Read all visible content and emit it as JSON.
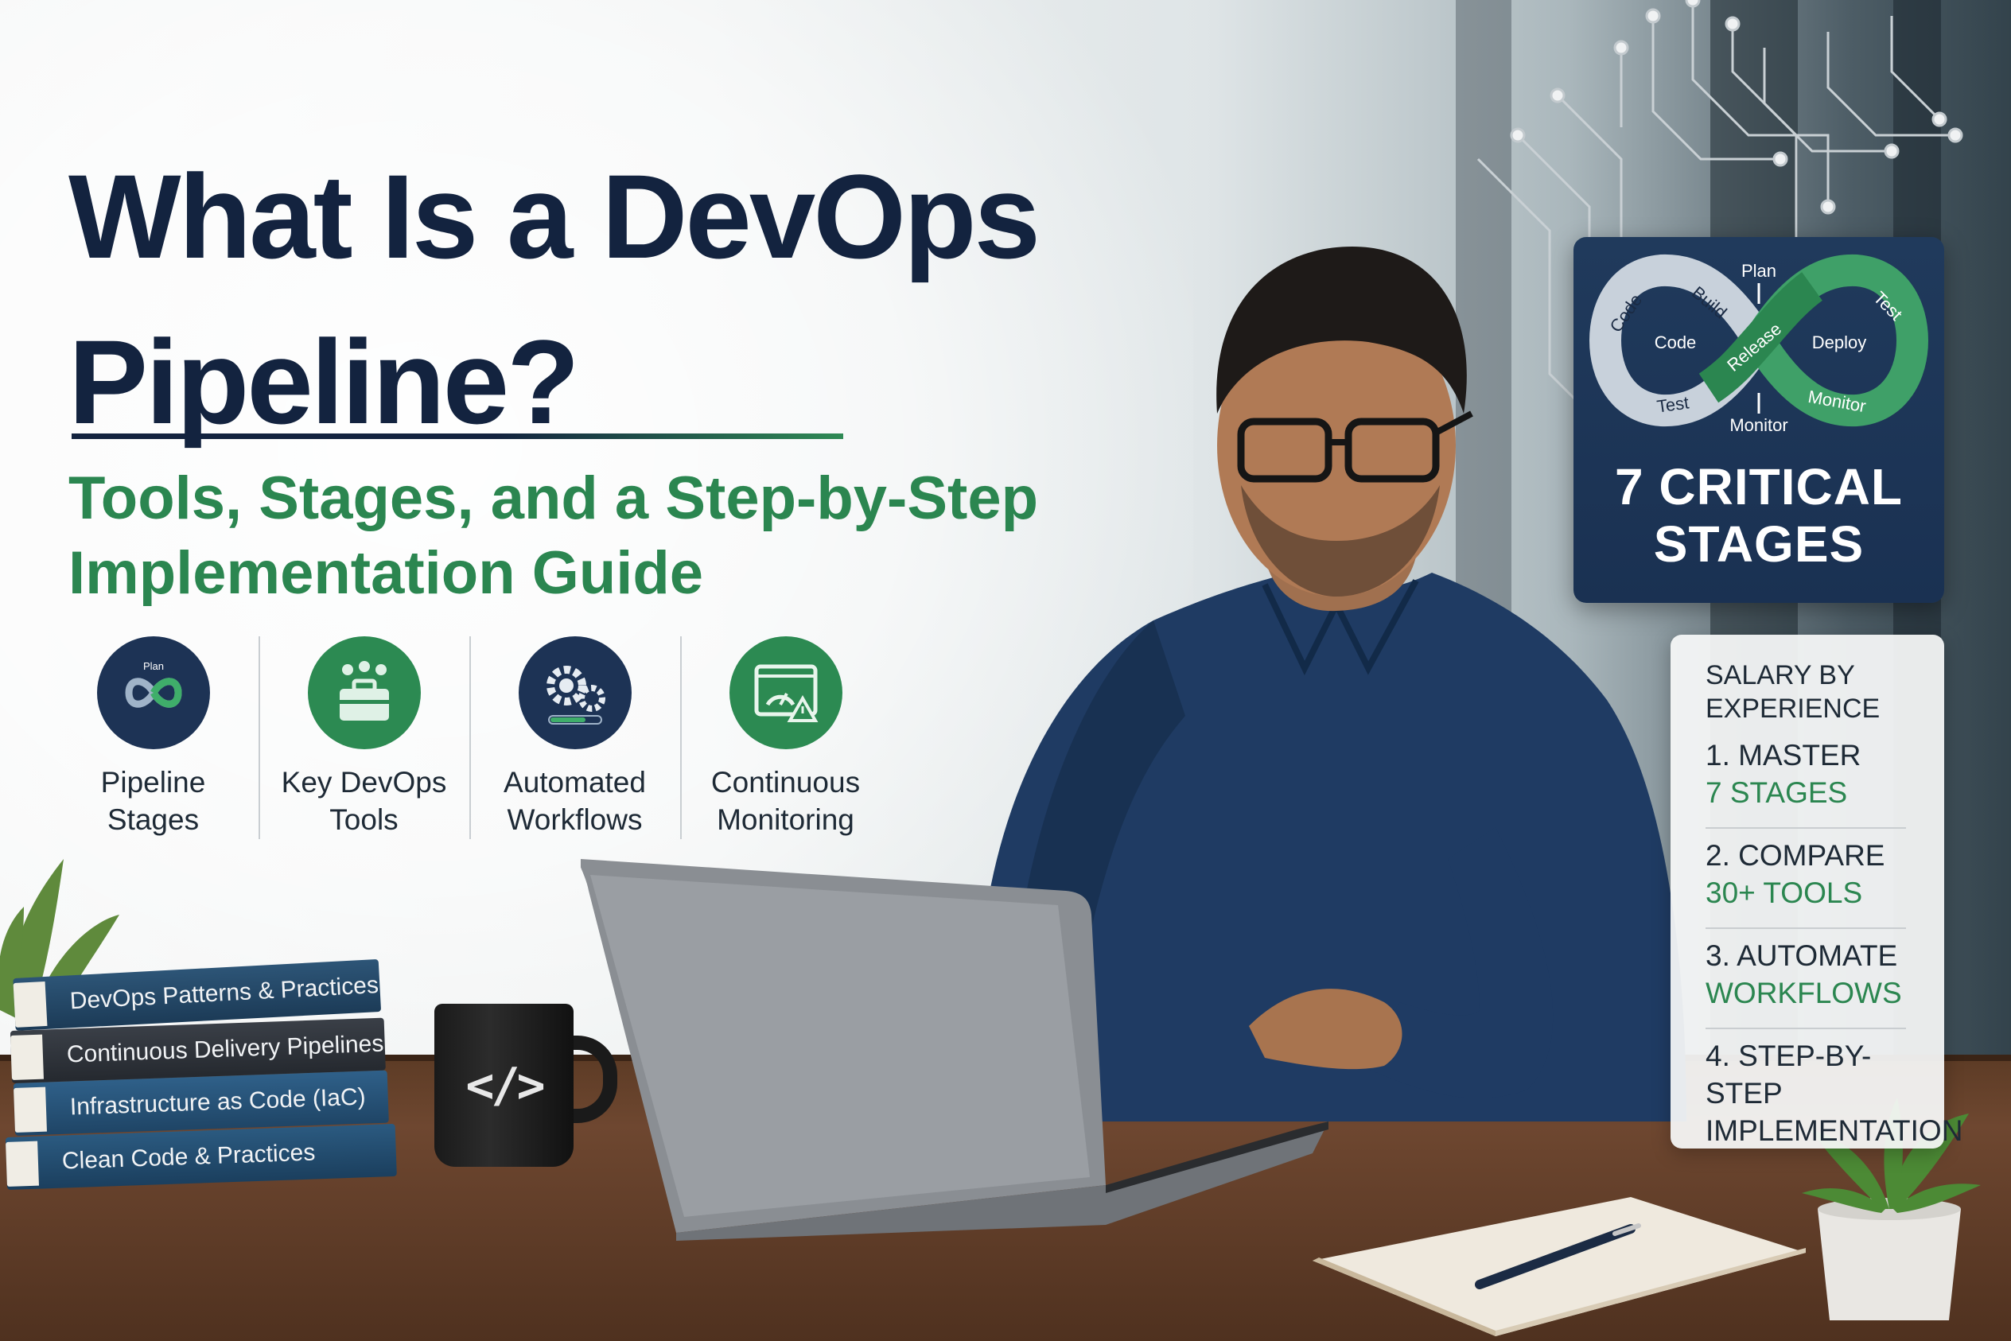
{
  "headline": {
    "title_line1": "What Is a DevOps",
    "title_line2": "Pipeline?",
    "subtitle_line1": "Tools, Stages, and a Step-by-Step",
    "subtitle_line2": "Implementation Guide"
  },
  "features": [
    {
      "line1": "Pipeline",
      "line2": "Stages",
      "icon": "infinity-loop-icon",
      "icon_text": "Plan"
    },
    {
      "line1": "Key DevOps",
      "line2": "Tools",
      "icon": "toolbox-icon"
    },
    {
      "line1": "Automated",
      "line2": "Workflows",
      "icon": "gears-icon"
    },
    {
      "line1": "Continuous",
      "line2": "Monitoring",
      "icon": "dashboard-alert-icon"
    }
  ],
  "stages_card": {
    "loop_labels": {
      "plan": "Plan",
      "code_outer": "Code",
      "build": "Build",
      "test_outer": "Test",
      "code_inner": "Code",
      "release": "Release",
      "deploy": "Deploy",
      "test_bottom": "Test",
      "monitor_outer": "Monitor",
      "monitor_bottom": "Monitor"
    },
    "line1": "7 CRITICAL",
    "line2": "STAGES"
  },
  "checklist": {
    "heading_line1": "SALARY BY",
    "heading_line2": "EXPERIENCE",
    "items": [
      {
        "a": "1. MASTER",
        "b": "7 STAGES"
      },
      {
        "a": "2. COMPARE",
        "b": "30+ TOOLS"
      },
      {
        "a": "3. AUTOMATE",
        "b": "WORKFLOWS"
      },
      {
        "a": "4. STEP-BY-STEP",
        "b": "IMPLEMENTATION"
      }
    ]
  },
  "books": [
    "DevOps Patterns & Practices",
    "Continuous Delivery Pipelines",
    "Infrastructure as Code (IaC)",
    "Clean Code & Practices"
  ],
  "mug": {
    "text": "</>"
  },
  "colors": {
    "navy": "#13233f",
    "green": "#2b8650",
    "card": "#1d3355"
  }
}
